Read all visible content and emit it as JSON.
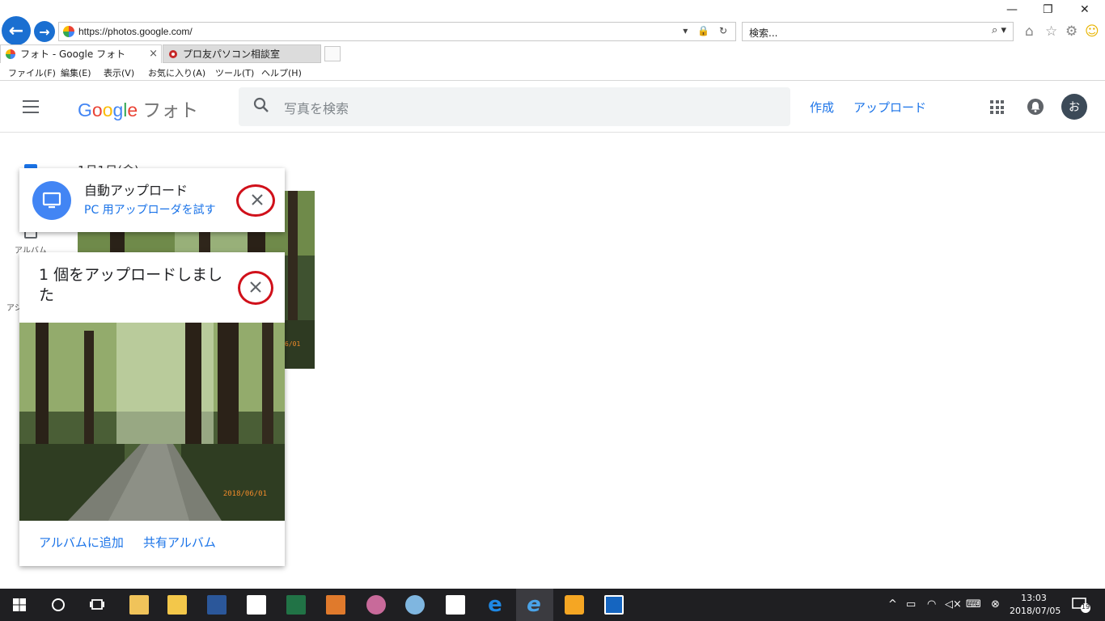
{
  "browser": {
    "url": "https://photos.google.com/",
    "search_placeholder": "検索...",
    "tabs": [
      {
        "label": "フォト - Google フォト",
        "active": true
      },
      {
        "label": "プロ友パソコン相談室",
        "active": false
      }
    ],
    "tab_close": "×",
    "menu": [
      "ファイル(F)",
      "編集(E)",
      "表示(V)",
      "お気に入り(A)",
      "ツール(T)",
      "ヘルプ(H)"
    ],
    "window_controls": {
      "minimize": "—",
      "restore": "❐",
      "close": "✕"
    }
  },
  "photos_header": {
    "logo_letters": [
      "G",
      "o",
      "o",
      "g",
      "l",
      "e"
    ],
    "product": "フォト",
    "search_placeholder": "写真を検索",
    "create_label": "作成",
    "upload_label": "アップロード",
    "avatar_initial": "お"
  },
  "background": {
    "date_label": "1月1日(金)",
    "album_label": "アルバム",
    "assist_label": "アシ"
  },
  "auto_upload_card": {
    "title": "自動アップロード",
    "link": "PC 用アップローダを試す"
  },
  "upload_card": {
    "title": "1 個をアップロードしました",
    "photo_date": "2018/06/01",
    "add_to_album": "アルバムに追加",
    "shared_album": "共有アルバム"
  },
  "background_photo_date": "6/01",
  "taskbar": {
    "time": "13:03",
    "date": "2018/07/05",
    "notifications": "19"
  },
  "colors": {
    "accent": "#1a73e8",
    "annotation_ring": "#d0101a",
    "taskbar": "#1f1f22"
  }
}
